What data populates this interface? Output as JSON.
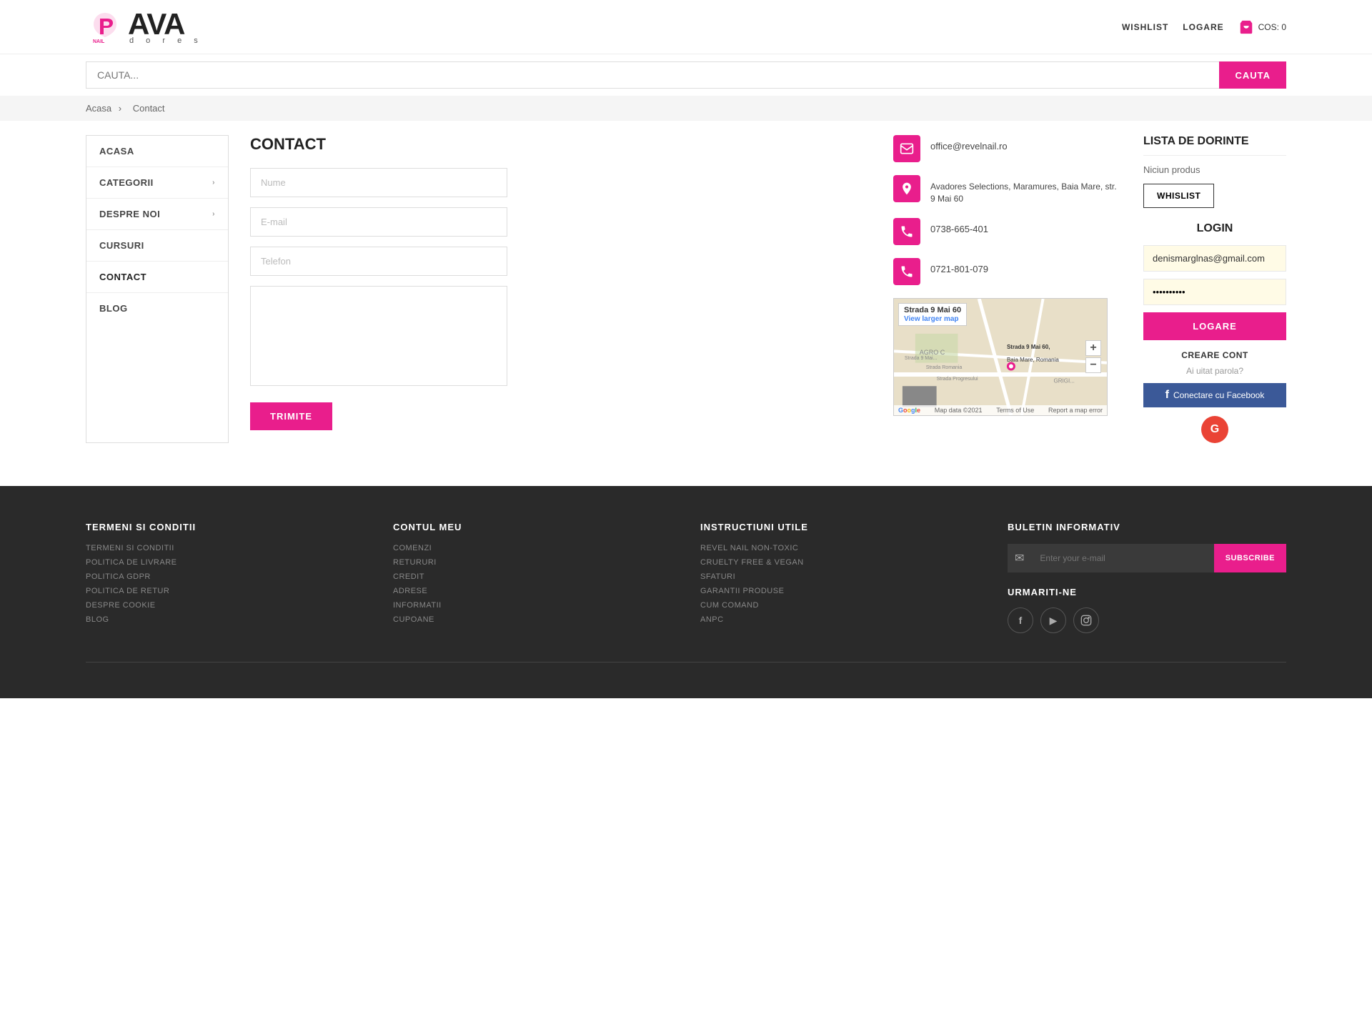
{
  "header": {
    "nav": {
      "wishlist": "WISHLIST",
      "login": "LOGARE",
      "cart_label": "COS: 0"
    }
  },
  "search": {
    "placeholder": "CAUTA...",
    "button": "CAUTA"
  },
  "breadcrumb": {
    "home": "Acasa",
    "current": "Contact"
  },
  "sidebar": {
    "items": [
      {
        "label": "ACASA",
        "has_arrow": false,
        "active": false
      },
      {
        "label": "CATEGORII",
        "has_arrow": true,
        "active": false
      },
      {
        "label": "DESPRE NOI",
        "has_arrow": true,
        "active": false
      },
      {
        "label": "CURSURI",
        "has_arrow": false,
        "active": false
      },
      {
        "label": "CONTACT",
        "has_arrow": false,
        "active": true
      },
      {
        "label": "BLOG",
        "has_arrow": false,
        "active": false
      }
    ]
  },
  "contact": {
    "title": "CONTACT",
    "name_placeholder": "Nume",
    "email_placeholder": "E-mail",
    "phone_placeholder": "Telefon",
    "message_placeholder": "",
    "send_button": "TRIMITE",
    "email_value": "office@revelnail.ro",
    "address_value": "Avadores Selections, Maramures, Baia Mare, str. 9 Mai 60",
    "phone1_value": "0738-665-401",
    "phone2_value": "0721-801-079",
    "map_label": "Strada 9 Mai 60",
    "map_link": "View larger map",
    "map_footer_data": "Map data ©2021",
    "map_footer_terms": "Terms of Use",
    "map_footer_report": "Report a map error"
  },
  "wishlist": {
    "title": "LISTA DE DORINTE",
    "no_product": "Niciun produs",
    "button": "WHISLIST"
  },
  "login": {
    "title": "LOGIN",
    "email_value": "denismarglnas@gmail.com",
    "password_placeholder": "••••••••••",
    "login_button": "LOGARE",
    "create_account": "CREARE CONT",
    "forgot_password": "Ai uitat parola?",
    "fb_connect": "Conectare cu Facebook"
  },
  "footer": {
    "col1": {
      "title": "TERMENI SI CONDITII",
      "links": [
        "TERMENI SI CONDITII",
        "POLITICA DE LIVRARE",
        "POLITICA GDPR",
        "POLITICA DE RETUR",
        "DESPRE COOKIE",
        "BLOG"
      ]
    },
    "col2": {
      "title": "CONTUL MEU",
      "links": [
        "COMENZI",
        "RETURURI",
        "CREDIT",
        "ADRESE",
        "INFORMATII",
        "CUPOANE"
      ]
    },
    "col3": {
      "title": "INSTRUCTIUNI UTILE",
      "links": [
        "REVEL NAIL NON-TOXIC",
        "CRUELTY FREE & VEGAN",
        "SFATURI",
        "GARANTII PRODUSE",
        "CUM COMAND",
        "ANPC"
      ]
    },
    "col4": {
      "newsletter_title": "BULETIN INFORMATIV",
      "newsletter_placeholder": "Enter your e-mail",
      "newsletter_button": "SUBSCRIBE",
      "social_title": "URMARITI-NE"
    }
  }
}
